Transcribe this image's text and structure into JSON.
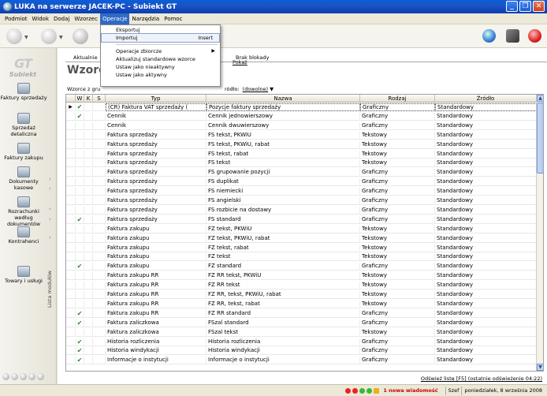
{
  "window": {
    "title": "LUKA na serwerze JACEK-PC - Subiekt GT",
    "controls": [
      "_",
      "❐",
      "✕"
    ]
  },
  "menu": [
    "Podmiot",
    "Widok",
    "Dodaj",
    "Wzorzec",
    "Operacje",
    "Narzędzia",
    "Pomoc"
  ],
  "dropdown": [
    {
      "label": "Eksportuj",
      "shortcut": "",
      "sub": false
    },
    {
      "label": "Importuj",
      "shortcut": "Insert",
      "sub": false
    },
    {
      "label": "Operacje zbiorcze",
      "shortcut": "",
      "sub": true
    },
    {
      "label": "Aktualizuj standardowe wzorce",
      "shortcut": "",
      "sub": false
    },
    {
      "label": "Ustaw jako nieaktywny",
      "shortcut": "",
      "sub": false
    },
    {
      "label": "Ustaw jako aktywny",
      "shortcut": "",
      "sub": false
    }
  ],
  "sidebar": {
    "logo": "Subiekt",
    "items": [
      "Faktury sprzedaży",
      "Sprzedaż detaliczna",
      "Faktury zakupu",
      "Dokumenty kasowe",
      "Rozrachunki według dokumentów",
      "Kontrahenci",
      "Towary i usługi"
    ],
    "vertical_label": "Lista modułów"
  },
  "tabs": {
    "left": "Aktualnie",
    "right": "Brak blokady",
    "right_link": "Pokaż"
  },
  "heading": "Wzorc",
  "filter": {
    "label": "Wzorce z gru",
    "source_label": "ródło:",
    "source_value": "(dowolne)"
  },
  "columns": [
    "W",
    "K",
    "S",
    "Typ",
    "Nazwa",
    "Rodzaj",
    "Źródło"
  ],
  "rows": [
    {
      "w": "✔",
      "k": "",
      "typ": "(CR) Faktura VAT sprzedaży (",
      "nazwa": "Pozycje faktury sprzedaży",
      "rodzaj": "Graficzny",
      "zrodlo": "Standardowy",
      "current": true
    },
    {
      "w": "✔",
      "k": "",
      "typ": "Cennik",
      "nazwa": "Cennik jednowierszowy",
      "rodzaj": "Graficzny",
      "zrodlo": "Standardowy"
    },
    {
      "w": "",
      "k": "",
      "typ": "Cennik",
      "nazwa": "Cennik dwuwierszowy",
      "rodzaj": "Graficzny",
      "zrodlo": "Standardowy"
    },
    {
      "w": "",
      "k": "",
      "typ": "Faktura sprzedaży",
      "nazwa": "FS tekst, PKWiU",
      "rodzaj": "Tekstowy",
      "zrodlo": "Standardowy"
    },
    {
      "w": "",
      "k": "",
      "typ": "Faktura sprzedaży",
      "nazwa": "FS tekst, PKWiU, rabat",
      "rodzaj": "Tekstowy",
      "zrodlo": "Standardowy"
    },
    {
      "w": "",
      "k": "",
      "typ": "Faktura sprzedaży",
      "nazwa": "FS tekst, rabat",
      "rodzaj": "Tekstowy",
      "zrodlo": "Standardowy"
    },
    {
      "w": "",
      "k": "",
      "typ": "Faktura sprzedaży",
      "nazwa": "FS tekst",
      "rodzaj": "Tekstowy",
      "zrodlo": "Standardowy"
    },
    {
      "w": "",
      "k": "",
      "typ": "Faktura sprzedaży",
      "nazwa": "FS grupowanie pozycji",
      "rodzaj": "Graficzny",
      "zrodlo": "Standardowy"
    },
    {
      "w": "",
      "k": "",
      "typ": "Faktura sprzedaży",
      "nazwa": "FS duplikat",
      "rodzaj": "Graficzny",
      "zrodlo": "Standardowy"
    },
    {
      "w": "",
      "k": "",
      "typ": "Faktura sprzedaży",
      "nazwa": "FS niemiecki",
      "rodzaj": "Graficzny",
      "zrodlo": "Standardowy"
    },
    {
      "w": "",
      "k": "",
      "typ": "Faktura sprzedaży",
      "nazwa": "FS angielski",
      "rodzaj": "Graficzny",
      "zrodlo": "Standardowy"
    },
    {
      "w": "",
      "k": "",
      "typ": "Faktura sprzedaży",
      "nazwa": "FS rozbicie na dostawy",
      "rodzaj": "Graficzny",
      "zrodlo": "Standardowy"
    },
    {
      "w": "✔",
      "k": "",
      "typ": "Faktura sprzedaży",
      "nazwa": "FS standard",
      "rodzaj": "Graficzny",
      "zrodlo": "Standardowy"
    },
    {
      "w": "",
      "k": "",
      "typ": "Faktura zakupu",
      "nazwa": "FZ tekst, PKWiU",
      "rodzaj": "Tekstowy",
      "zrodlo": "Standardowy"
    },
    {
      "w": "",
      "k": "",
      "typ": "Faktura zakupu",
      "nazwa": "FZ tekst, PKWiU, rabat",
      "rodzaj": "Tekstowy",
      "zrodlo": "Standardowy"
    },
    {
      "w": "",
      "k": "",
      "typ": "Faktura zakupu",
      "nazwa": "FZ tekst, rabat",
      "rodzaj": "Tekstowy",
      "zrodlo": "Standardowy"
    },
    {
      "w": "",
      "k": "",
      "typ": "Faktura zakupu",
      "nazwa": "FZ tekst",
      "rodzaj": "Tekstowy",
      "zrodlo": "Standardowy"
    },
    {
      "w": "✔",
      "k": "",
      "typ": "Faktura zakupu",
      "nazwa": "FZ standard",
      "rodzaj": "Graficzny",
      "zrodlo": "Standardowy"
    },
    {
      "w": "",
      "k": "",
      "typ": "Faktura zakupu RR",
      "nazwa": "FZ RR tekst, PKWiU",
      "rodzaj": "Tekstowy",
      "zrodlo": "Standardowy"
    },
    {
      "w": "",
      "k": "",
      "typ": "Faktura zakupu RR",
      "nazwa": "FZ RR tekst",
      "rodzaj": "Tekstowy",
      "zrodlo": "Standardowy"
    },
    {
      "w": "",
      "k": "",
      "typ": "Faktura zakupu RR",
      "nazwa": "FZ RR, tekst, PKWiU, rabat",
      "rodzaj": "Tekstowy",
      "zrodlo": "Standardowy"
    },
    {
      "w": "",
      "k": "",
      "typ": "Faktura zakupu RR",
      "nazwa": "FZ RR, tekst, rabat",
      "rodzaj": "Tekstowy",
      "zrodlo": "Standardowy"
    },
    {
      "w": "✔",
      "k": "",
      "typ": "Faktura zakupu RR",
      "nazwa": "FZ RR standard",
      "rodzaj": "Graficzny",
      "zrodlo": "Standardowy"
    },
    {
      "w": "✔",
      "k": "",
      "typ": "Faktura zaliczkowa",
      "nazwa": "FSzal standard",
      "rodzaj": "Graficzny",
      "zrodlo": "Standardowy"
    },
    {
      "w": "",
      "k": "",
      "typ": "Faktura zaliczkowa",
      "nazwa": "FSzal tekst",
      "rodzaj": "Tekstowy",
      "zrodlo": "Standardowy"
    },
    {
      "w": "✔",
      "k": "",
      "typ": "Historia rozliczenia",
      "nazwa": "Historia rozliczenia",
      "rodzaj": "Graficzny",
      "zrodlo": "Standardowy"
    },
    {
      "w": "✔",
      "k": "",
      "typ": "Historia windykacji",
      "nazwa": "Historia windykacji",
      "rodzaj": "Graficzny",
      "zrodlo": "Standardowy"
    },
    {
      "w": "✔",
      "k": "",
      "typ": "Informacje o instytucji",
      "nazwa": "Informacje o instytucji",
      "rodzaj": "Graficzny",
      "zrodlo": "Standardowy"
    }
  ],
  "refresh_text": "Odśwież listę [F5] (ostatnie odświeżenie 04:22)",
  "status": {
    "message": "1 nowa wiadomość",
    "user": "Szef",
    "date": "poniedziałek, 8 września 2008"
  },
  "colors": {
    "title_bar": "#0c45c0",
    "highlight": "#316ac5",
    "check": "#2a8a2a"
  }
}
